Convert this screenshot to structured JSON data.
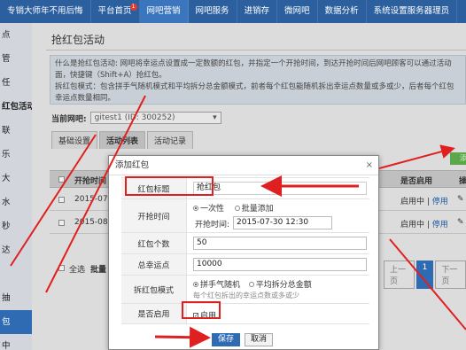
{
  "topnav": {
    "items": [
      {
        "label": "专销大师年不用后悔",
        "active": false,
        "badge": ""
      },
      {
        "label": "平台首页",
        "active": false,
        "badge": "1"
      },
      {
        "label": "网吧营销",
        "active": true,
        "badge": ""
      },
      {
        "label": "网吧服务",
        "active": false,
        "badge": ""
      },
      {
        "label": "进销存",
        "active": false,
        "badge": ""
      },
      {
        "label": "微网吧",
        "active": false,
        "badge": ""
      },
      {
        "label": "数据分析",
        "active": false,
        "badge": ""
      },
      {
        "label": "系统设置服务器理员",
        "active": false,
        "badge": ""
      }
    ]
  },
  "sidebar": {
    "items": [
      {
        "label": "点"
      },
      {
        "label": "管"
      },
      {
        "label": "任"
      },
      {
        "label": "红包活动"
      },
      {
        "label": "联"
      },
      {
        "label": "乐"
      },
      {
        "label": "大"
      },
      {
        "label": "水"
      },
      {
        "label": "秒"
      },
      {
        "label": "达"
      },
      {
        "label": ""
      },
      {
        "label": "抽"
      },
      {
        "label": "包"
      },
      {
        "label": "中"
      }
    ]
  },
  "main": {
    "title": "抢红包活动",
    "info_lines": [
      "什么是抢红包活动: 网吧将幸运点设置成一定数额的红包，并指定一个开抢时间，到达开抢时间后网吧顾客可以通过活动",
      "面，快捷键（Shift+A）抢红包。",
      "拆红包模式：包含拼手气随机模式和平均拆分总金额模式，前者每个红包能随机拆出幸运点数量或多或少，后者每个红包",
      "幸运点数量相同。"
    ],
    "wechat_label": "当前网吧:",
    "wechat_value": "gitest1 (ID: 300252)",
    "tabs": [
      {
        "label": "基础设置",
        "active": false
      },
      {
        "label": "活动列表",
        "active": true
      },
      {
        "label": "活动记录",
        "active": false
      }
    ],
    "add_button": "添",
    "table": {
      "headers": {
        "start_time": "开抢时间",
        "enabled": "是否启用",
        "ops": "操"
      },
      "rows": [
        {
          "start_time": "2015-07-",
          "status": "启用中",
          "action": "停用"
        },
        {
          "start_time": "2015-08-",
          "status": "启用中",
          "action": "停用"
        }
      ]
    },
    "select_all": "全选",
    "batch": "批量",
    "pager": {
      "prev": "上一页",
      "current": "1",
      "next": "下一页"
    }
  },
  "dialog": {
    "title": "添加红包",
    "close": "×",
    "fields": {
      "name_label": "红包标题",
      "name_value": "抢红包",
      "time_label": "开抢时间",
      "time_mode_once": "一次性",
      "time_mode_batch": "批量添加",
      "time_sub_label": "开抢时间:",
      "time_value": "2015-07-30 12:30",
      "count_label": "红包个数",
      "count_value": "50",
      "total_label": "总幸运点",
      "total_value": "10000",
      "mode_label": "拆红包模式",
      "mode_random": "拼手气随机",
      "mode_average": "平均拆分总金额",
      "mode_hint": "每个红包拆出的幸运点数或多或少",
      "enable_label": "是否启用",
      "enable_value": "启用"
    },
    "save": "保存",
    "cancel": "取消"
  },
  "colors": {
    "nav": "#2b5f9e",
    "primary": "#2f6bb3",
    "annotation": "#e02020",
    "add_button": "#5aa84a"
  }
}
